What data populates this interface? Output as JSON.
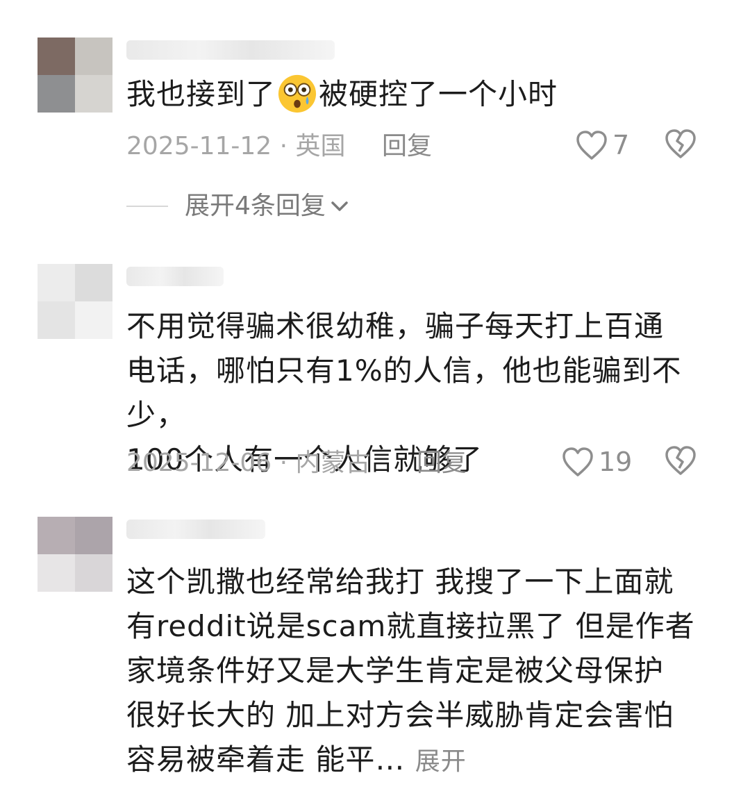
{
  "comments": [
    {
      "text_before_emoji": "我也接到了",
      "emoji": "astonished-face-emoji",
      "text_after_emoji": "被硬控了一个小时",
      "time_location": "2025-11-12 · 英国",
      "reply_label": "回复",
      "likes": "7",
      "expand_replies_label": "展开4条回复"
    },
    {
      "text_lines": [
        "不用觉得骗术很幼稚，骗子每天打上百通",
        "电话，哪怕只有1%的人信，他也能骗到不少，",
        "100个人有一个人信就够了"
      ],
      "time_location": "2025-12-06 · 内蒙古",
      "reply_label": "回复",
      "likes": "19"
    },
    {
      "text_lines": [
        "这个凯撒也经常给我打 我搜了一下上面就",
        "有reddit说是scam就直接拉黑了 但是作者",
        "家境条件好又是大学生肯定是被父母保护",
        "很好长大的 加上对方会半威胁肯定会害怕",
        "容易被牵着走 能平…"
      ],
      "more_label": "展开"
    }
  ],
  "icons": {
    "like": "heart-outline-icon",
    "dislike": "broken-heart-outline-icon",
    "expand": "chevron-down-icon"
  },
  "colors": {
    "text": "#1c1c1c",
    "meta": "#a6a6a6",
    "icon": "#8e8e8e"
  }
}
